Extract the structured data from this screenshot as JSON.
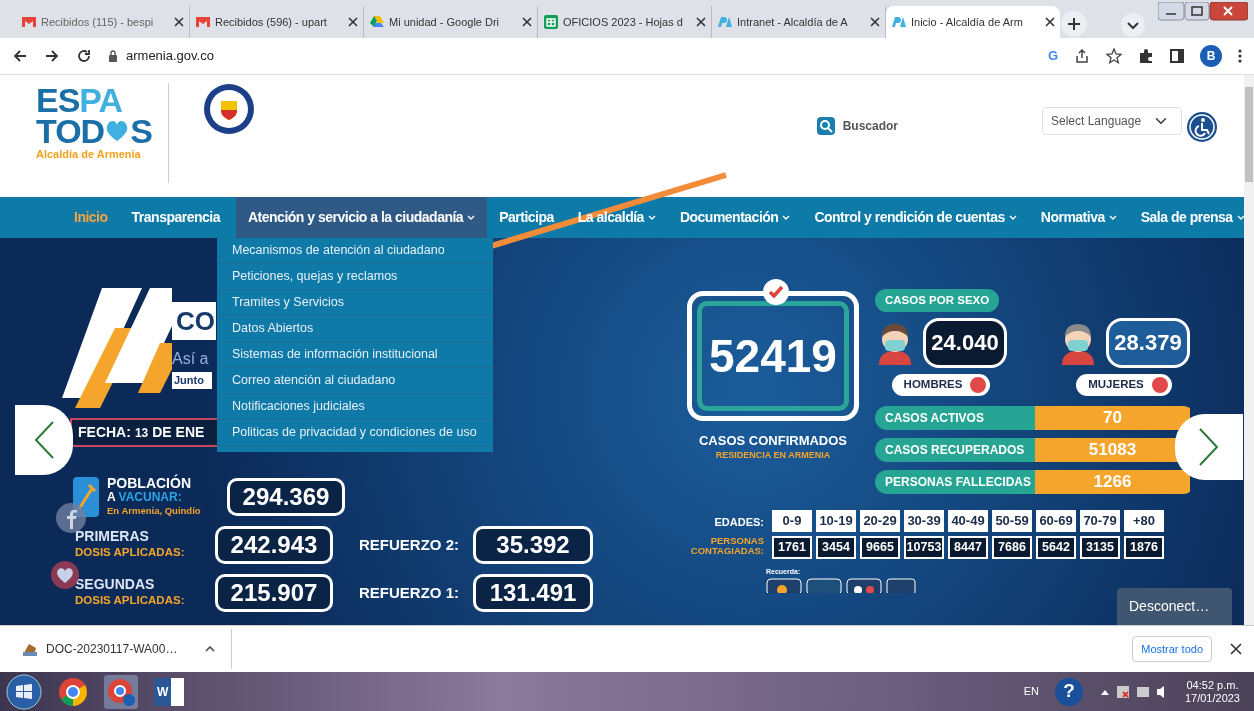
{
  "browser": {
    "tabs": [
      {
        "title": "Recibidos (115) - bespi",
        "kind": "gmail",
        "selected": false
      },
      {
        "title": "Recibidos (596) - upart",
        "kind": "gmail",
        "selected": false
      },
      {
        "title": "Mi unidad - Google Dri",
        "kind": "drive",
        "selected": false
      },
      {
        "title": "OFICIOS 2023 - Hojas d",
        "kind": "sheets",
        "selected": false
      },
      {
        "title": "Intranet - Alcaldía de A",
        "kind": "site",
        "selected": false
      },
      {
        "title": "Inicio - Alcaldía de Arm",
        "kind": "site",
        "selected": true
      }
    ],
    "address": "armenia.gov.co",
    "google_letter": "G",
    "profile_initial": "B"
  },
  "site": {
    "logo": {
      "top_dark": "ES",
      "top_light": "PA",
      "bottom_left": "TOD",
      "bottom_right": "S",
      "caption": "Alcaldía de Armenia"
    },
    "search_label": "Buscador",
    "language_select": "Select Language",
    "nav": [
      {
        "label": "Inicio",
        "current": true,
        "expanded": false,
        "has_dropdown": false
      },
      {
        "label": "Transparencia",
        "current": false,
        "expanded": false,
        "has_dropdown": false
      },
      {
        "label": "Atención y servicio a la ciudadanía",
        "current": false,
        "expanded": true,
        "has_dropdown": true
      },
      {
        "label": "Participa",
        "current": false,
        "expanded": false,
        "has_dropdown": false
      },
      {
        "label": "La alcaldía",
        "current": false,
        "expanded": false,
        "has_dropdown": true
      },
      {
        "label": "Documentación",
        "current": false,
        "expanded": false,
        "has_dropdown": true
      },
      {
        "label": "Control y rendición de cuentas",
        "current": false,
        "expanded": false,
        "has_dropdown": true
      },
      {
        "label": "Normativa",
        "current": false,
        "expanded": false,
        "has_dropdown": true
      },
      {
        "label": "Sala de prensa",
        "current": false,
        "expanded": false,
        "has_dropdown": true
      }
    ],
    "dropdown": [
      "Mecanismos de atención al ciudadano",
      "Peticiones, quejas y reclamos",
      "Tramites y Servicios",
      "Datos Abiertos",
      "Sistemas de información institucional",
      "Correo atención al ciudadano",
      "Notificaciones judiciales",
      "Politicas de privacidad y condiciones de uso"
    ],
    "banner": {
      "headline": "CO",
      "subline": "Así a",
      "subline2": "Junto",
      "date_label": "FECHA:",
      "date_day": "13",
      "date_month": "DE ENE",
      "population": {
        "title": "POBLACIÓN",
        "prefix": "A",
        "highlight": "VACUNAR:",
        "place": "En Armenia, Quindío",
        "value": "294.369"
      },
      "doses": [
        {
          "title": "PRIMERAS",
          "subtitle": "DOSIS APLICADAS:",
          "value": "242.943",
          "booster_label": "REFUERZO 2:",
          "booster_value": "35.392"
        },
        {
          "title": "SEGUNDAS",
          "subtitle": "DOSIS APLICADAS:",
          "value": "215.907",
          "booster_label": "REFUERZO 1:",
          "booster_value": "131.491"
        }
      ],
      "confirmed": {
        "value": "52419",
        "label": "CASOS CONFIRMADOS",
        "sublabel": "RESIDENCIA EN ARMENIA"
      },
      "by_sex": {
        "title": "CASOS POR SEXO",
        "groups": [
          {
            "kind": "man",
            "value": "24.040",
            "label": "HOMBRES"
          },
          {
            "kind": "woman",
            "value": "28.379",
            "label": "MUJERES"
          }
        ]
      },
      "status_bars": [
        {
          "label": "CASOS ACTIVOS",
          "value": "70"
        },
        {
          "label": "CASOS RECUPERADOS",
          "value": "51083"
        },
        {
          "label": "PERSONAS FALLECIDAS",
          "value": "1266"
        }
      ],
      "ages": {
        "label": "EDADES:",
        "count_label": "PERSONAS CONTAGIADAS:",
        "columns": [
          {
            "range": "0-9",
            "count": "1761"
          },
          {
            "range": "10-19",
            "count": "3454"
          },
          {
            "range": "20-29",
            "count": "9665"
          },
          {
            "range": "30-39",
            "count": "10753"
          },
          {
            "range": "40-49",
            "count": "8447"
          },
          {
            "range": "50-59",
            "count": "7686"
          },
          {
            "range": "60-69",
            "count": "5642"
          },
          {
            "range": "70-79",
            "count": "3135"
          },
          {
            "range": "+80",
            "count": "1876"
          }
        ]
      },
      "reminder_label": "Recuerda:"
    },
    "toast": "Desconect…"
  },
  "downloads": {
    "file": "DOC-20230117-WA00…",
    "show_all": "Mostrar todo"
  },
  "taskbar": {
    "word_letter": "W",
    "help_symbol": "?",
    "language": "EN",
    "time": "04:52 p.m.",
    "date": "17/01/2023"
  }
}
